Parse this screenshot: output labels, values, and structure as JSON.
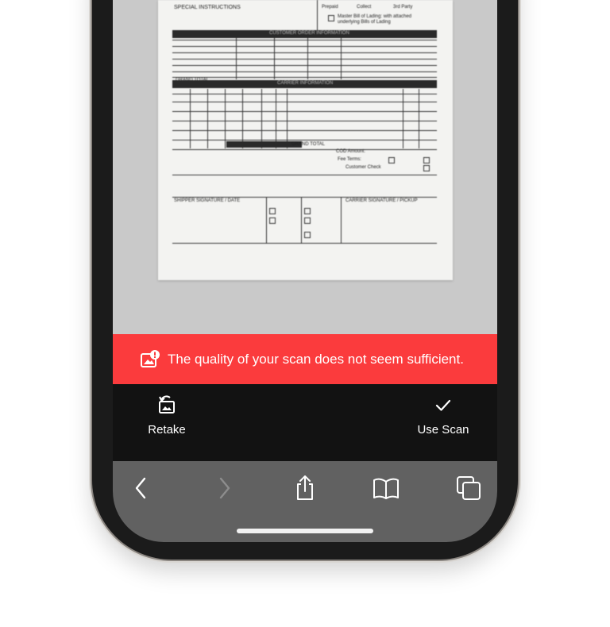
{
  "banner": {
    "message": "The quality of your scan does not seem sufficient.",
    "background": "#fb3b3d",
    "icon": "image-warning-icon"
  },
  "actions": {
    "retake_label": "Retake",
    "retake_icon": "retake-photo-icon",
    "use_scan_label": "Use Scan",
    "use_scan_icon": "checkmark-icon"
  },
  "document": {
    "special_instructions": "SPECIAL INSTRUCTIONS",
    "prepaid": "Prepaid",
    "collect": "Collect",
    "third_party": "3rd Party",
    "master_bol": "Master Bill of Lading: with attached underlying Bills of Lading",
    "customer_order_info": "CUSTOMER ORDER INFORMATION",
    "carrier_info": "CARRIER INFORMATION",
    "shipper_signature": "SHIPPER SIGNATURE / DATE",
    "carrier_signature": "CARRIER SIGNATURE / PICKUP",
    "grand_total": "GRAND TOTAL",
    "cod_amount": "COD Amount:",
    "fee_terms": "Fee Terms:",
    "customer_check": "Customer Check"
  },
  "toolbar": {
    "back_icon": "chevron-left-icon",
    "forward_icon": "chevron-right-icon",
    "share_icon": "share-icon",
    "bookmarks_icon": "book-icon",
    "tabs_icon": "tabs-icon"
  }
}
